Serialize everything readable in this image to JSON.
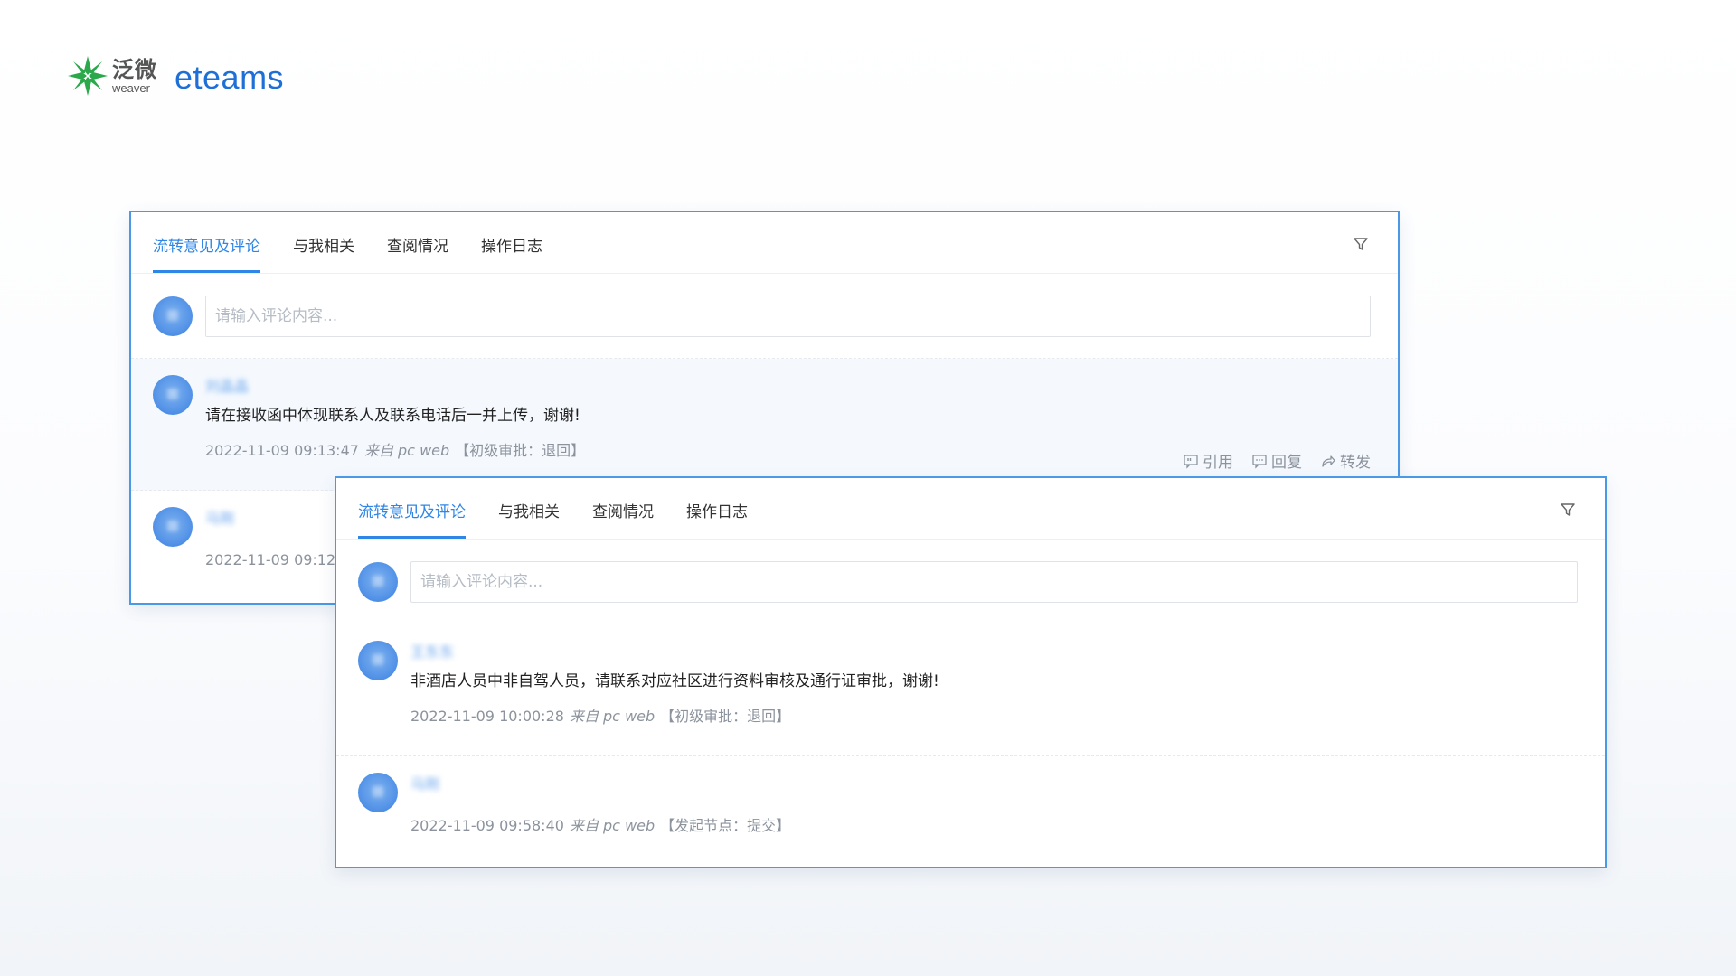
{
  "brand": {
    "name_cn": "泛微",
    "name_sub": "weaver",
    "product": "eteams",
    "colors": {
      "green": "#2aa84a",
      "blue": "#1e6fd6"
    }
  },
  "theme": {
    "accent": "#2f86e6",
    "border": "#4b98e6"
  },
  "panel_back": {
    "tabs": [
      "流转意见及评论",
      "与我相关",
      "查阅情况",
      "操作日志"
    ],
    "active_tab": 0,
    "input_placeholder": "请输入评论内容...",
    "comments": [
      {
        "author": "刘晶晶",
        "text": "请在接收函中体现联系人及联系电话后一并上传，谢谢!",
        "time": "2022-11-09 09:13:47",
        "source": "来自 pc web",
        "node": "【初级审批：退回】",
        "actions": [
          "引用",
          "回复",
          "转发"
        ]
      },
      {
        "author": "马刚",
        "text": "",
        "time": "2022-11-09 09:12",
        "source": "",
        "node": ""
      }
    ]
  },
  "panel_front": {
    "tabs": [
      "流转意见及评论",
      "与我相关",
      "查阅情况",
      "操作日志"
    ],
    "active_tab": 0,
    "input_placeholder": "请输入评论内容...",
    "comments": [
      {
        "author": "王东东",
        "text": "非酒店人员中非自驾人员，请联系对应社区进行资料审核及通行证审批，谢谢!",
        "time": "2022-11-09 10:00:28",
        "source": "来自 pc web",
        "node": "【初级审批：退回】"
      },
      {
        "author": "马刚",
        "text": "",
        "time": "2022-11-09 09:58:40",
        "source": "来自 pc web",
        "node": "【发起节点：提交】"
      }
    ]
  },
  "icons": [
    "filter-icon",
    "quote-icon",
    "reply-icon",
    "forward-icon",
    "avatar"
  ]
}
